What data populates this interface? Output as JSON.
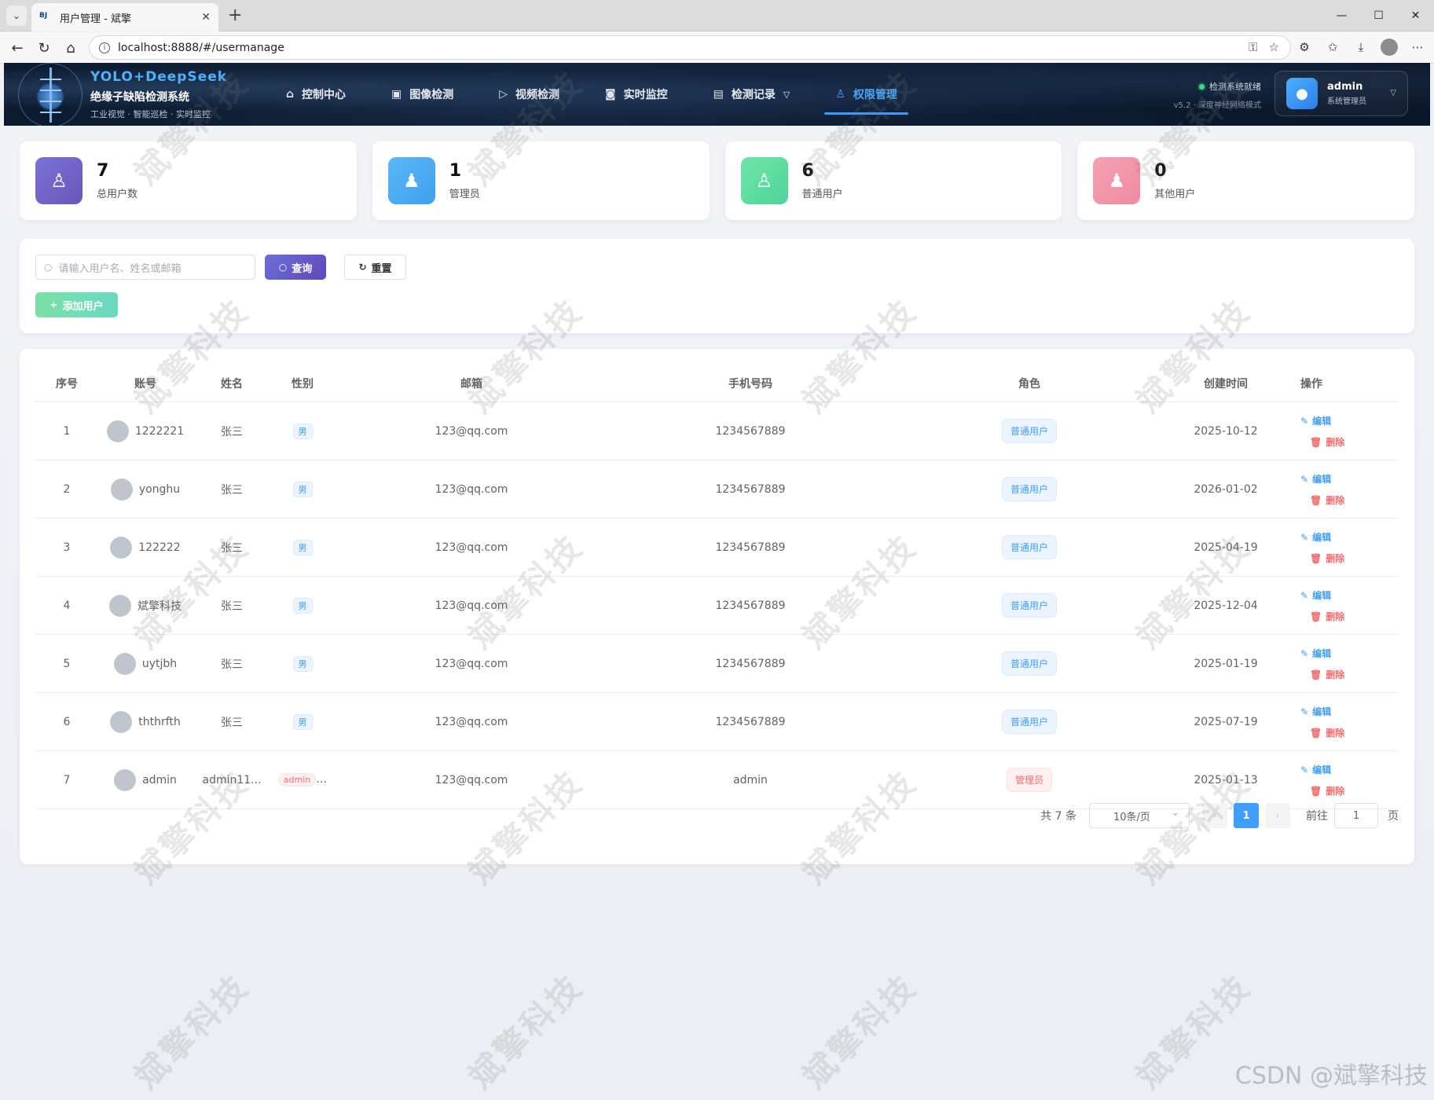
{
  "browser": {
    "tab_title": "用户管理 - 斌擎",
    "tab_favicon": "BJ",
    "url": "localhost:8888/#/usermanage"
  },
  "header": {
    "brand_title": "YOLO+DeepSeek",
    "brand_subtitle": "绝缘子缺陷检测系统",
    "brand_tagline": "工业视觉 · 智能巡检 · 实时监控",
    "nav": [
      {
        "label": "控制中心",
        "icon": "home-icon"
      },
      {
        "label": "图像检测",
        "icon": "image-icon"
      },
      {
        "label": "视频检测",
        "icon": "play-icon"
      },
      {
        "label": "实时监控",
        "icon": "camera-icon"
      },
      {
        "label": "检测记录",
        "icon": "document-icon"
      },
      {
        "label": "权限管理",
        "icon": "user-icon"
      }
    ],
    "active_nav": "权限管理",
    "status_text": "检测系统就绪",
    "version_text": "v5.2 · 深度神经网络模式",
    "user_name": "admin",
    "user_role": "系统管理员"
  },
  "stats": [
    {
      "value": "7",
      "label": "总用户数"
    },
    {
      "value": "1",
      "label": "管理员"
    },
    {
      "value": "6",
      "label": "普通用户"
    },
    {
      "value": "0",
      "label": "其他用户"
    }
  ],
  "search": {
    "placeholder": "请输入用户名、姓名或邮箱",
    "query_label": "查询",
    "reset_label": "重置",
    "add_label": "添加用户"
  },
  "table": {
    "headers": [
      "序号",
      "账号",
      "姓名",
      "性别",
      "邮箱",
      "手机号码",
      "角色",
      "创建时间",
      "操作"
    ],
    "edit_label": "编辑",
    "delete_label": "删除",
    "rows": [
      {
        "idx": "1",
        "account": "1222221",
        "name": "张三",
        "sex": "男",
        "email": "123@qq.com",
        "phone": "1234567889",
        "role": "普通用户",
        "created": "2025-10-12"
      },
      {
        "idx": "2",
        "account": "yonghu",
        "name": "张三",
        "sex": "男",
        "email": "123@qq.com",
        "phone": "1234567889",
        "role": "普通用户",
        "created": "2026-01-02"
      },
      {
        "idx": "3",
        "account": "122222",
        "name": "张三",
        "sex": "男",
        "email": "123@qq.com",
        "phone": "1234567889",
        "role": "普通用户",
        "created": "2025-04-19"
      },
      {
        "idx": "4",
        "account": "斌擎科技",
        "name": "张三",
        "sex": "男",
        "email": "123@qq.com",
        "phone": "1234567889",
        "role": "普通用户",
        "created": "2025-12-04"
      },
      {
        "idx": "5",
        "account": "uytjbh",
        "name": "张三",
        "sex": "男",
        "email": "123@qq.com",
        "phone": "1234567889",
        "role": "普通用户",
        "created": "2025-01-19"
      },
      {
        "idx": "6",
        "account": "ththrfth",
        "name": "张三",
        "sex": "男",
        "email": "123@qq.com",
        "phone": "1234567889",
        "role": "普通用户",
        "created": "2025-07-19"
      },
      {
        "idx": "7",
        "account": "admin",
        "name": "admin11...",
        "sex": "admin",
        "email": "123@qq.com",
        "phone": "admin",
        "role": "管理员",
        "created": "2025-01-13"
      }
    ]
  },
  "pagination": {
    "total_text": "共 7 条",
    "page_size": "10条/页",
    "current_page": "1",
    "goto_label": "前往",
    "goto_value": "1",
    "page_suffix": "页"
  },
  "watermark_text": "斌擎科技",
  "csdn_watermark": "CSDN @斌擎科技"
}
